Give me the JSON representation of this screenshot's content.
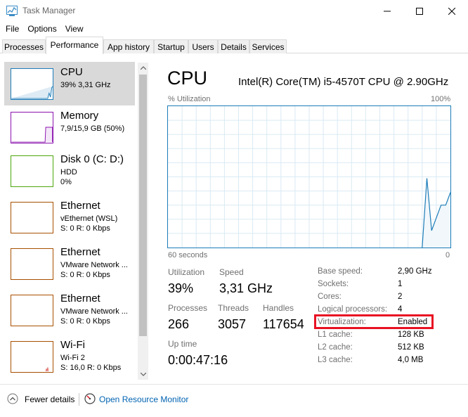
{
  "window": {
    "title": "Task Manager"
  },
  "menu": [
    "File",
    "Options",
    "View"
  ],
  "tabs": [
    "Processes",
    "Performance",
    "App history",
    "Startup",
    "Users",
    "Details",
    "Services"
  ],
  "active_tab": "Performance",
  "colors": {
    "cpu": "#1c7cb8",
    "memory": "#8b12ae",
    "disk": "#4da60c",
    "ethernet": "#a74f01",
    "wifi": "#a74f01",
    "highlight": "#e81123",
    "link": "#0063b1"
  },
  "sidebar": {
    "items": [
      {
        "name": "CPU",
        "line1": "39% 3,31 GHz",
        "line2": ""
      },
      {
        "name": "Memory",
        "line1": "7,9/15,9 GB (50%)",
        "line2": ""
      },
      {
        "name": "Disk 0 (C: D:)",
        "line1": "HDD",
        "line2": "0%"
      },
      {
        "name": "Ethernet",
        "line1": "vEthernet (WSL)",
        "line2": "S: 0 R: 0 Kbps"
      },
      {
        "name": "Ethernet",
        "line1": "VMware Network ...",
        "line2": "S: 0 R: 0 Kbps"
      },
      {
        "name": "Ethernet",
        "line1": "VMware Network ...",
        "line2": "S: 0 R: 0 Kbps"
      },
      {
        "name": "Wi-Fi",
        "line1": "Wi-Fi 2",
        "line2": "S: 16,0 R: 0 Kbps"
      }
    ]
  },
  "main": {
    "title": "CPU",
    "cpu_model": "Intel(R) Core(TM) i5-4570T CPU @ 2.90GHz",
    "graph": {
      "y_label": "% Utilization",
      "y_max_label": "100%",
      "x_label": "60 seconds",
      "x_min_label": "0",
      "values": [
        0,
        0,
        0,
        0,
        0,
        0,
        0,
        0,
        0,
        0,
        0,
        0,
        0,
        0,
        0,
        0,
        0,
        0,
        0,
        0,
        0,
        0,
        0,
        0,
        0,
        0,
        0,
        0,
        0,
        0,
        0,
        0,
        0,
        0,
        0,
        0,
        0,
        0,
        0,
        0,
        0,
        0,
        0,
        0,
        0,
        0,
        0,
        0,
        0,
        0,
        0,
        0,
        0,
        0,
        0,
        49,
        12,
        21,
        30,
        30,
        39
      ]
    },
    "stats": {
      "utilization_label": "Utilization",
      "utilization": "39%",
      "speed_label": "Speed",
      "speed": "3,31 GHz",
      "processes_label": "Processes",
      "processes": "266",
      "threads_label": "Threads",
      "threads": "3057",
      "handles_label": "Handles",
      "handles": "117654",
      "uptime_label": "Up time",
      "uptime": "0:00:47:16"
    },
    "info": [
      {
        "label": "Base speed:",
        "value": "2,90 GHz"
      },
      {
        "label": "Sockets:",
        "value": "1"
      },
      {
        "label": "Cores:",
        "value": "2"
      },
      {
        "label": "Logical processors:",
        "value": "4"
      },
      {
        "label": "Virtualization:",
        "value": "Enabled"
      },
      {
        "label": "L1 cache:",
        "value": "128 KB"
      },
      {
        "label": "L2 cache:",
        "value": "512 KB"
      },
      {
        "label": "L3 cache:",
        "value": "4,0 MB"
      }
    ]
  },
  "footer": {
    "fewer_details": "Fewer details",
    "open_resource_monitor": "Open Resource Monitor"
  }
}
